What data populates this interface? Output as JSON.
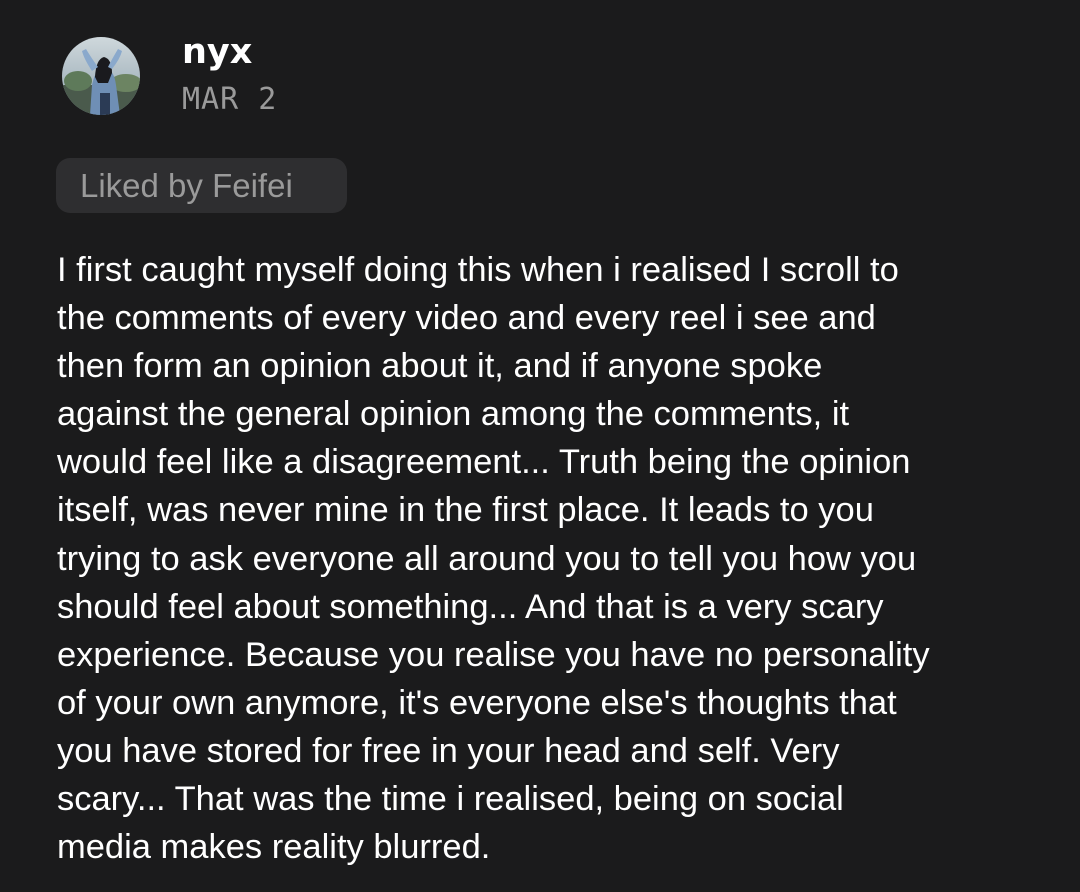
{
  "post": {
    "author": "nyx",
    "date": "MAR 2",
    "liked_by": "Liked by Feifei",
    "body_lines": [
      "I first caught myself doing this when i realised I scroll to",
      "the comments of every video and every reel i see and",
      "then form an opinion about it, and if anyone spoke",
      "against the general opinion among the comments, it",
      "would feel like a disagreement... Truth being the opinion",
      "itself, was never mine in the first place. It leads to you",
      "trying to ask everyone all around you to tell you how you",
      "should feel about something... And that is a very scary",
      "experience. Because you realise you have no personality",
      "of your own anymore, it's everyone else's thoughts that",
      "you have stored for free in your head and self. Very",
      "scary... That was the time i realised, being on social",
      "media makes reality blurred."
    ]
  },
  "colors": {
    "background": "#1b1b1c",
    "text_primary": "#ffffff",
    "text_secondary": "#9a9a9a",
    "chip_background": "#2e2e30"
  }
}
